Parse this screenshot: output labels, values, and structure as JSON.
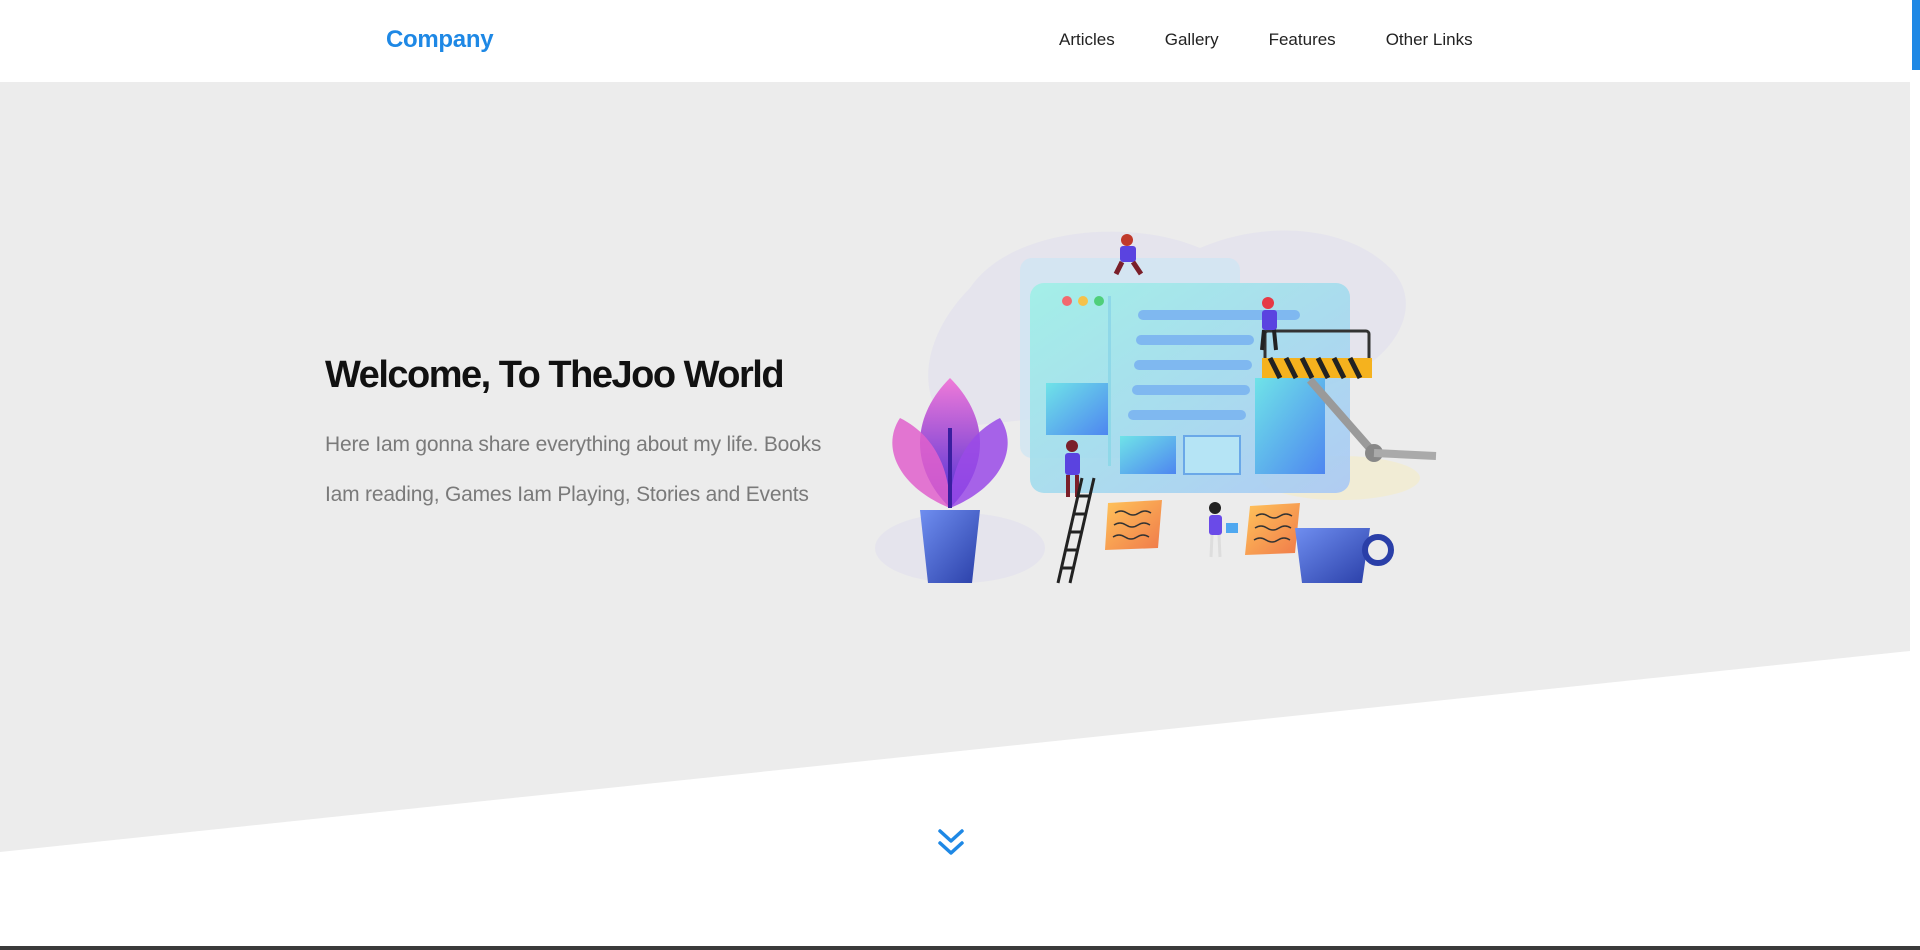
{
  "navbar": {
    "brand": "Company",
    "links": [
      {
        "label": "Articles"
      },
      {
        "label": "Gallery"
      },
      {
        "label": "Features"
      },
      {
        "label": "Other Links"
      }
    ]
  },
  "hero": {
    "title": "Welcome, To TheJoo World",
    "text": "Here Iam gonna share everything about my life. Books Iam reading, Games Iam Playing, Stories and Events"
  },
  "colors": {
    "accent": "#1e88e5",
    "hero_background": "#ececec",
    "title": "#111111",
    "body_text": "#7a7a7a"
  },
  "icons": {
    "scroll_down": "double-chevron-down-icon"
  }
}
